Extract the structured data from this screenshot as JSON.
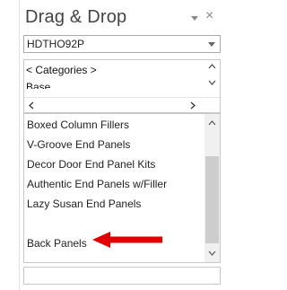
{
  "panel": {
    "title": "Drag & Drop",
    "close_glyph": "×",
    "dropdown_icon": "chevron-down-icon"
  },
  "catalog_select": {
    "value": "HDTHO92P"
  },
  "categories": {
    "header": "< Categories >",
    "next_item_partial": "Base"
  },
  "items": [
    "Boxed Column Fillers",
    "V-Groove End Panels",
    "Decor Door End Panel Kits",
    "Authentic End Panels w/Filler",
    "Lazy Susan End Panels",
    "",
    "Back Panels"
  ],
  "annotation": {
    "arrow_color": "#e00000",
    "points_to": "Back Panels"
  },
  "footer": {
    "value": ""
  }
}
